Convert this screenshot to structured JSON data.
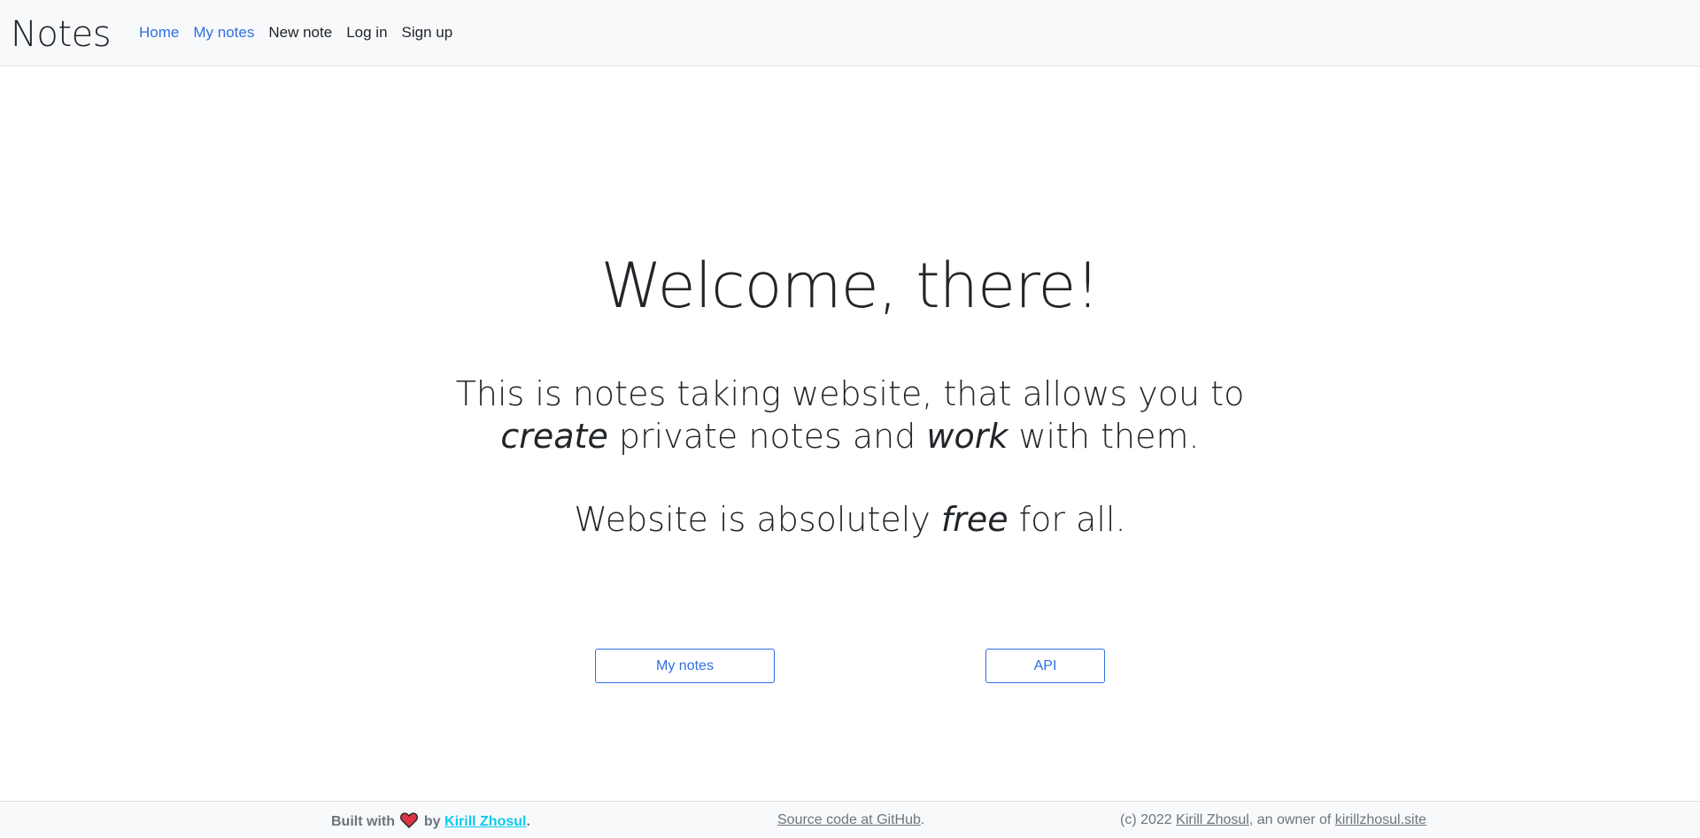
{
  "navbar": {
    "brand": "Notes",
    "links": [
      {
        "label": "Home",
        "active": true
      },
      {
        "label": "My notes",
        "active": true
      },
      {
        "label": "New note",
        "active": false
      },
      {
        "label": "Log in",
        "active": false
      },
      {
        "label": "Sign up",
        "active": false
      }
    ]
  },
  "hero": {
    "title": "Welcome, there!",
    "lead1_part1": "This is notes taking website, that allows you to",
    "lead1_em1": "create",
    "lead1_part2": " private notes and ",
    "lead1_em2": "work",
    "lead1_part3": " with them.",
    "lead2_part1": "Website is absolutely ",
    "lead2_em": "free",
    "lead2_part2": " for all.",
    "buttons": {
      "my_notes": "My notes",
      "api": "API"
    }
  },
  "footer": {
    "built_with": "Built with",
    "by": "by",
    "author": "Kirill Zhosul",
    "period": ".",
    "source": "Source code at GitHub",
    "source_period": ".",
    "copyright": "(c) 2022 ",
    "copyright_author": "Kirill Zhosul",
    "owner_text": ", an owner of ",
    "site": "kirillzhosul.site",
    "heart_icon": "heart-icon",
    "heart_color": "#dc3545"
  },
  "colors": {
    "accent": "#2f6fe0",
    "navbar_bg": "#f8f9fa",
    "footer_link": "#0dcaf0"
  }
}
